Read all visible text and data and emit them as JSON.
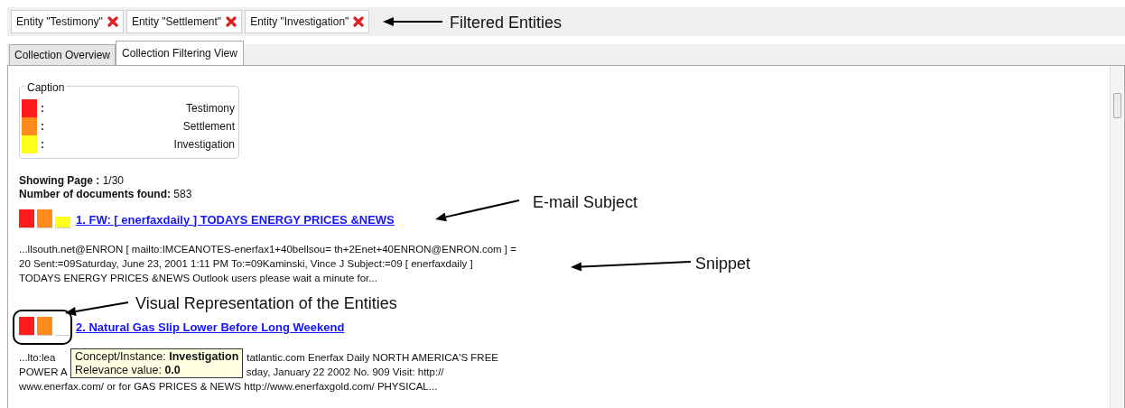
{
  "filter_chips": [
    {
      "label": "Entity \"Testimony\""
    },
    {
      "label": "Entity \"Settlement\""
    },
    {
      "label": "Entity \"Investigation\""
    }
  ],
  "tabs": [
    {
      "label": "Collection Overview",
      "selected": false
    },
    {
      "label": "Collection Filtering View",
      "selected": true
    }
  ],
  "caption": {
    "title": "Caption",
    "entries": [
      {
        "color": "#ff1c1c",
        "separator": ":",
        "label": "Testimony"
      },
      {
        "color": "#ff8c1c",
        "separator": ":",
        "label": "Settlement"
      },
      {
        "color": "#ffff1c",
        "separator": ":",
        "label": "Investigation"
      }
    ]
  },
  "summary": {
    "page_label": "Showing Page :",
    "page_value": "1/30",
    "count_label": "Number of documents found:",
    "count_value": "583"
  },
  "results": [
    {
      "title": "1. FW: [ enerfaxdaily ] TODAYS ENERGY PRICES &NEWS",
      "entities": [
        {
          "color": "#ff1c1c",
          "level": 1
        },
        {
          "color": "#ff8c1c",
          "level": 1
        },
        {
          "color": "#ffff1c",
          "level": 0.6
        }
      ],
      "snippet_lines": [
        [
          "...llsouth.net@ENRON [ mailto:IMCEANOTES-enerfax1+40bellsou= th+2Enet+40ENRON@ENRON.com ] ="
        ],
        [
          "20 Sent:=09Saturday, June 23, 2001 1:11 PM To:=09Kaminski, Vince J Subject:=09 [ enerfaxdaily ]"
        ],
        [
          "TODAYS ENERGY PRICES &NEWS Outlook users please wait a minute for..."
        ]
      ]
    },
    {
      "title": "2. Natural Gas Slip Lower Before Long Weekend ",
      "entities": [
        {
          "color": "#ff1c1c",
          "level": 1
        },
        {
          "color": "#ff8c1c",
          "level": 1
        },
        {
          "level": 0
        }
      ],
      "snippet_lines": [
        [
          "...lto:lea",
          "tatlantic.com Enerfax Daily NORTH AMERICA'S FREE"
        ],
        [
          "POWER A",
          "sday, January 22 2002 No. 909 Visit: http://"
        ],
        [
          "www.enerfax.com/ or for GAS PRICES & NEWS http://www.enerfaxgold.com/ PHYSICAL..."
        ]
      ]
    }
  ],
  "tooltip": {
    "text": "Concept/Instance: **Investigation**",
    "relevance": "Relevance value: **0.0**"
  },
  "annotations": [
    {
      "text": "Filtered Entities"
    },
    {
      "text": "E-mail Subject"
    },
    {
      "text": "Snippet"
    },
    {
      "text": "Visual Representation of the Entities"
    }
  ]
}
